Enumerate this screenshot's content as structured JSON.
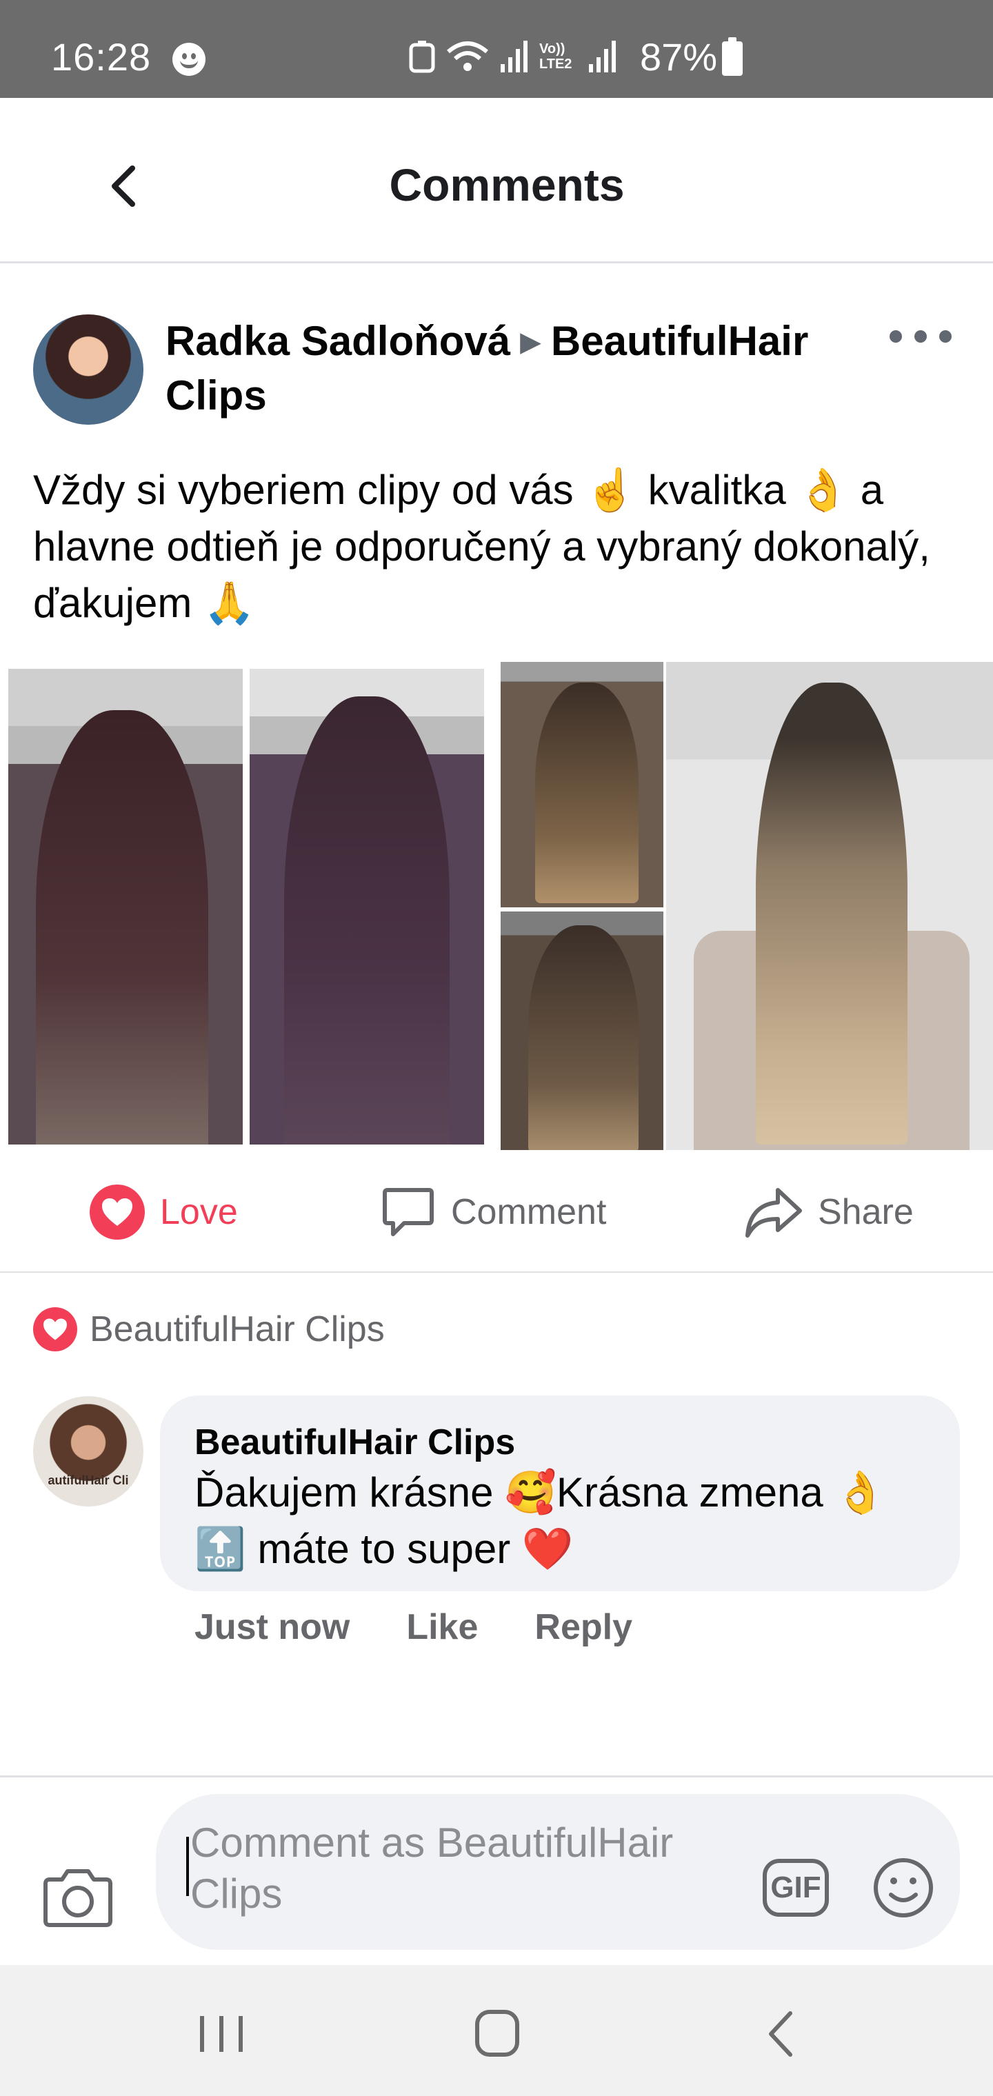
{
  "status_bar": {
    "time": "16:28",
    "battery": "87%",
    "network_label": "Vo)) LTE2"
  },
  "header": {
    "title": "Comments"
  },
  "post": {
    "author": "Radka Sadloňová",
    "target": "BeautifulHair Clips",
    "text": "Vždy si vyberiem clipy od vás ☝️ kvalitka 👌 a hlavne odtieň je odporučený a vybraný dokonalý, ďakujem 🙏"
  },
  "actions": {
    "love": "Love",
    "comment": "Comment",
    "share": "Share"
  },
  "reactions": {
    "reactor": "BeautifulHair Clips"
  },
  "comment": {
    "author": "BeautifulHair Clips",
    "text": "Ďakujem krásne 🥰Krásna zmena 👌 🔝 máte to super ❤️",
    "time": "Just now",
    "like": "Like",
    "reply": "Reply",
    "avatar_text": "autifulHair Cli"
  },
  "composer": {
    "placeholder": "Comment as BeautifulHair Clips",
    "gif": "GIF"
  },
  "colors": {
    "love": "#f33e58",
    "secondary_text": "#65676b",
    "bubble": "#f0f2f5",
    "status_bar": "#6c6c6c"
  }
}
